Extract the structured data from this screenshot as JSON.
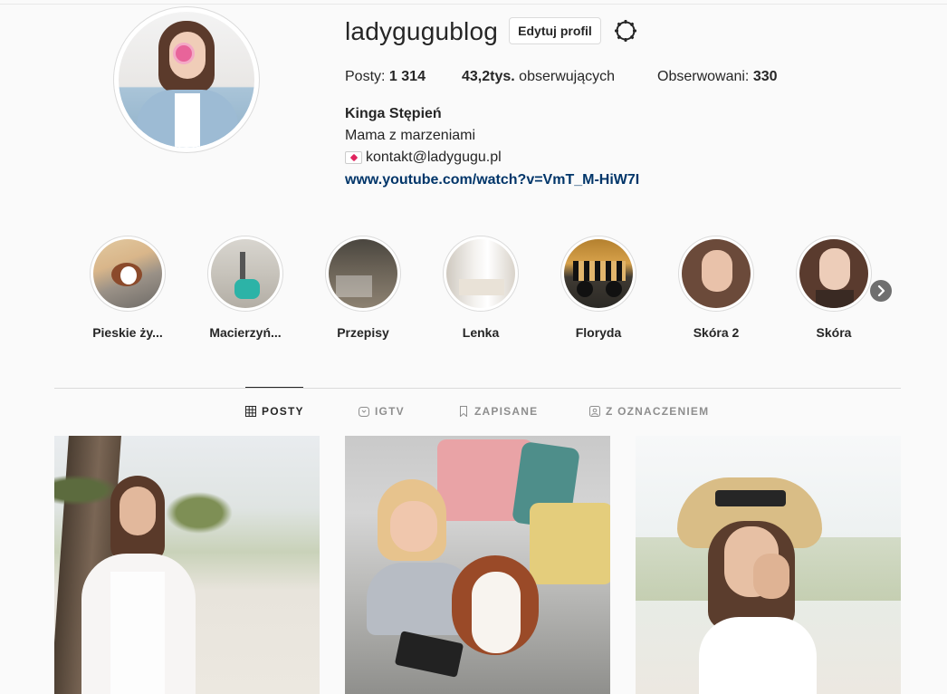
{
  "profile": {
    "username": "ladygugublog",
    "edit_label": "Edytuj profil",
    "stats": {
      "posts_label": "Posty:",
      "posts_value": "1 314",
      "followers_value": "43,2tys.",
      "followers_label": "obserwujących",
      "following_label": "Obserwowani:",
      "following_value": "330"
    },
    "bio": {
      "name": "Kinga Stępień",
      "tagline": "Mama z marzeniami",
      "email": "kontakt@ladygugu.pl",
      "link": "www.youtube.com/watch?v=VmT_M-HiW7I"
    }
  },
  "highlights": [
    {
      "label": "Pieskie ży..."
    },
    {
      "label": "Macierzyń..."
    },
    {
      "label": "Przepisy"
    },
    {
      "label": "Lenka"
    },
    {
      "label": "Floryda"
    },
    {
      "label": "Skóra 2"
    },
    {
      "label": "Skóra"
    }
  ],
  "tabs": [
    {
      "label": "POSTY",
      "icon": "grid-icon",
      "active": true
    },
    {
      "label": "IGTV",
      "icon": "igtv-icon",
      "active": false
    },
    {
      "label": "ZAPISANE",
      "icon": "bookmark-icon",
      "active": false
    },
    {
      "label": "Z OZNACZENIEM",
      "icon": "tagged-icon",
      "active": false
    }
  ],
  "colors": {
    "background": "#fafafa",
    "text": "#262626",
    "secondary_text": "#8e8e8e",
    "link": "#003569",
    "border": "#dbdbdb"
  }
}
